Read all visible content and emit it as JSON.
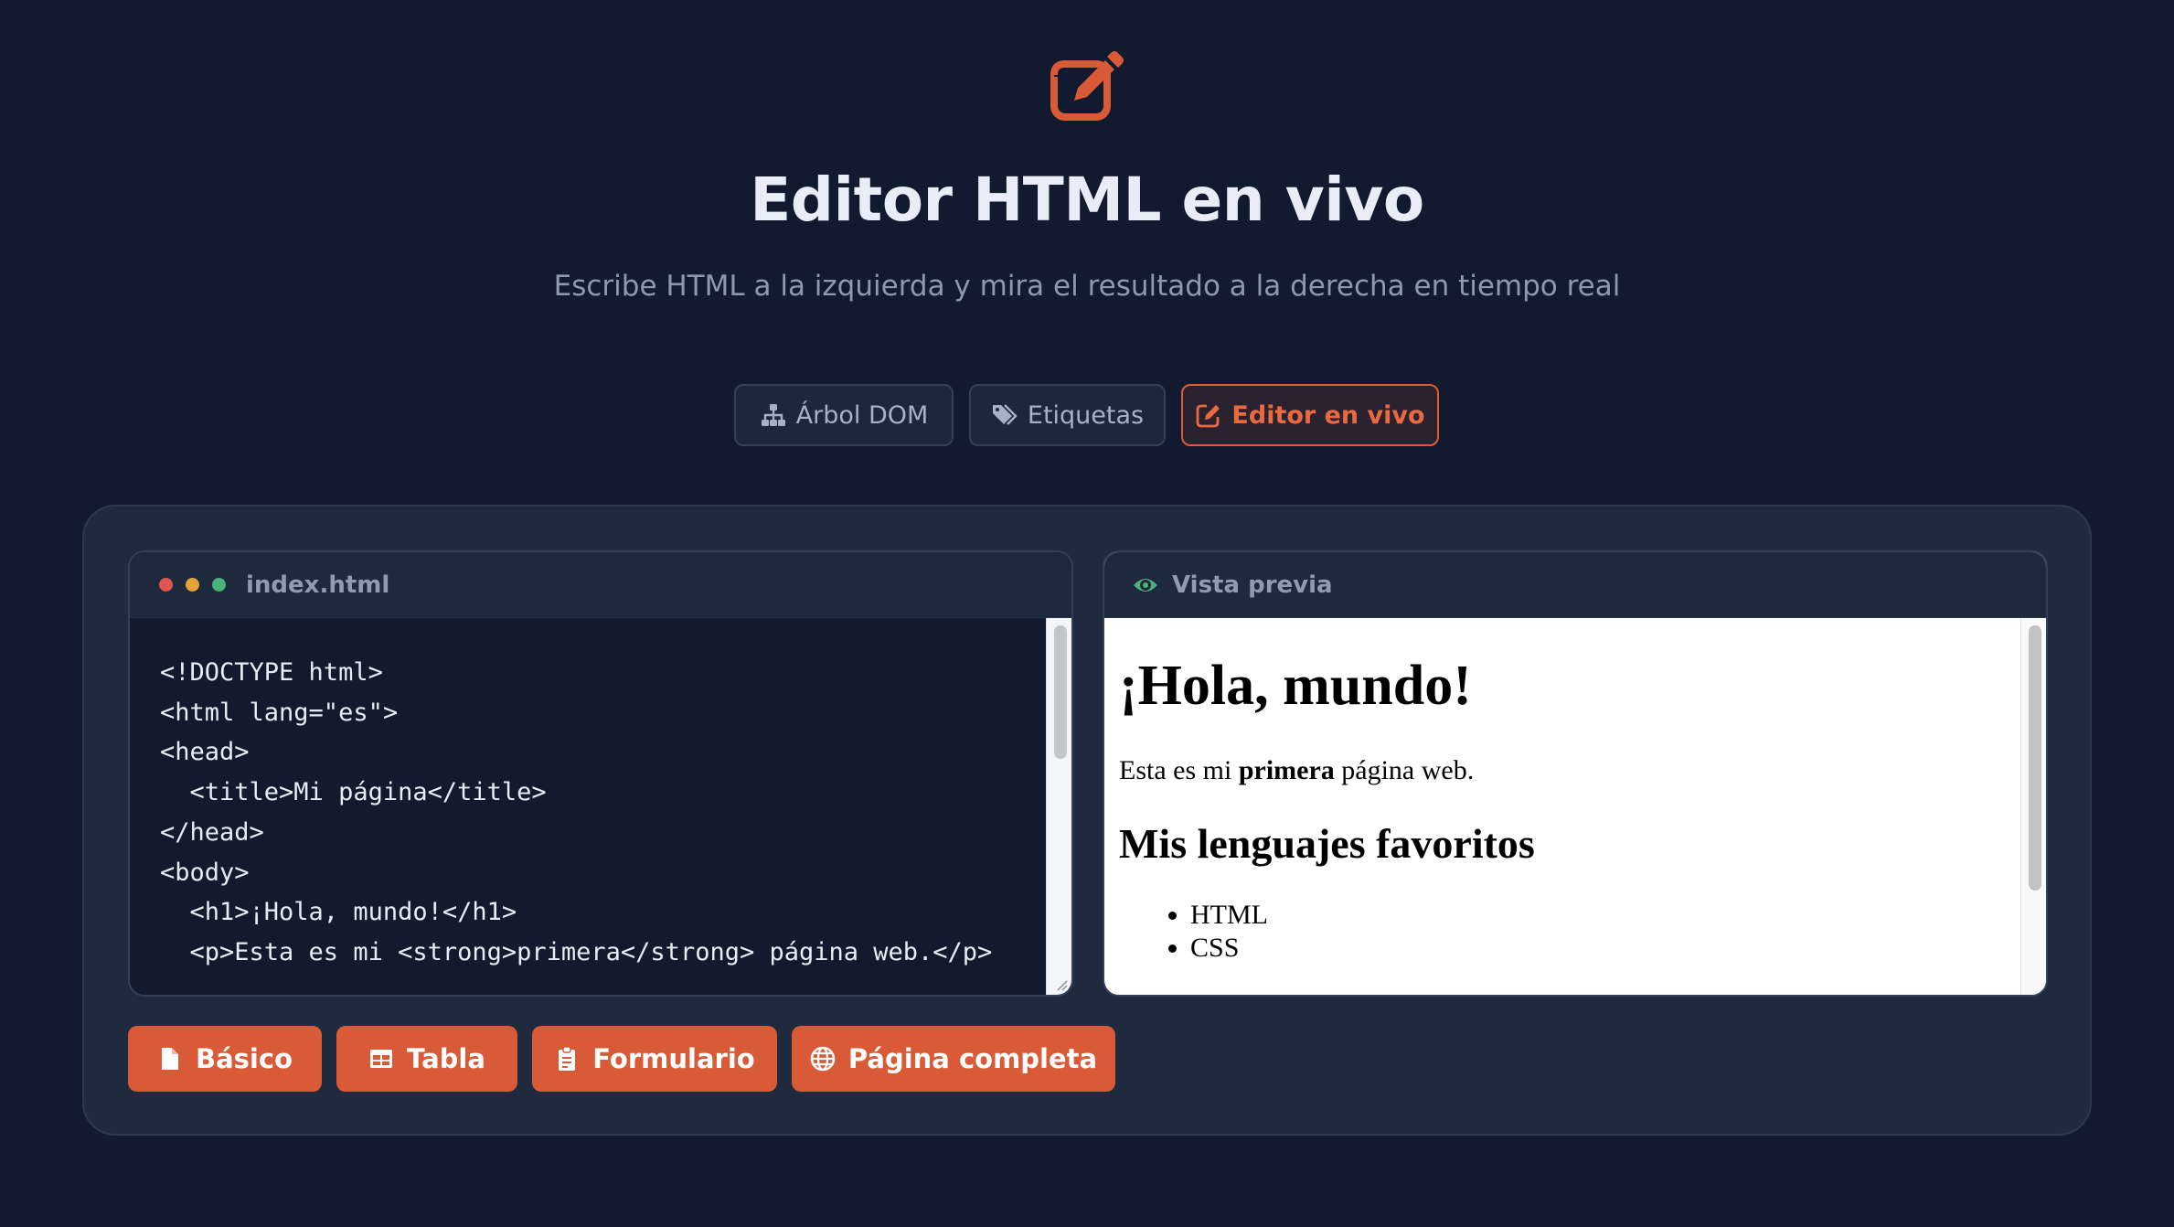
{
  "header": {
    "title": "Editor HTML en vivo",
    "subtitle": "Escribe HTML a la izquierda y mira el resultado a la derecha en tiempo real",
    "logo_icon": "edit-icon",
    "accent_color": "#e05a35"
  },
  "nav": {
    "tabs": [
      {
        "label": "Árbol DOM",
        "icon": "sitemap-icon",
        "active": false
      },
      {
        "label": "Etiquetas",
        "icon": "tags-icon",
        "active": false
      },
      {
        "label": "Editor en vivo",
        "icon": "edit-icon",
        "active": true
      }
    ]
  },
  "editor": {
    "file_name": "index.html",
    "code": "<!DOCTYPE html>\n<html lang=\"es\">\n<head>\n  <title>Mi página</title>\n</head>\n<body>\n  <h1>¡Hola, mundo!</h1>\n  <p>Esta es mi <strong>primera</strong> página web.</p>"
  },
  "preview": {
    "label": "Vista previa",
    "icon": "eye-icon",
    "h1": "¡Hola, mundo!",
    "p_before": "Esta es mi ",
    "p_strong": "primera",
    "p_after": " página web.",
    "h2": "Mis lenguajes favoritos",
    "list": [
      "HTML",
      "CSS"
    ]
  },
  "templates": [
    {
      "label": "Básico",
      "icon": "file-icon"
    },
    {
      "label": "Tabla",
      "icon": "table-icon"
    },
    {
      "label": "Formulario",
      "icon": "clipboard-icon"
    },
    {
      "label": "Página completa",
      "icon": "globe-icon"
    }
  ]
}
